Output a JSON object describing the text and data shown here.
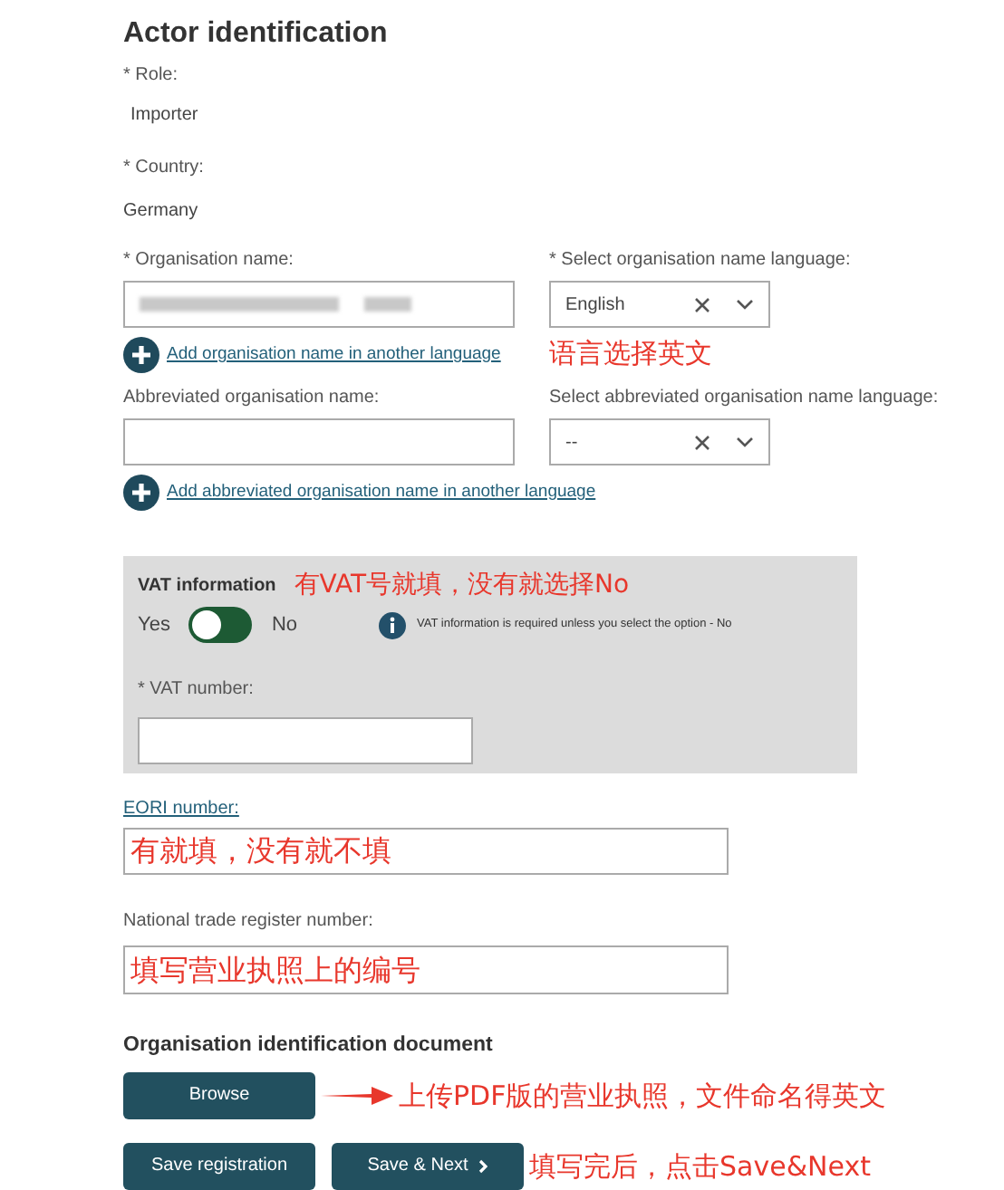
{
  "title": "Actor identification",
  "role": {
    "label": "* Role:",
    "value": "Importer"
  },
  "country": {
    "label": "* Country:",
    "value": "Germany"
  },
  "org_name": {
    "label": "* Organisation name:",
    "redacted": true,
    "add_link": "Add organisation name in another language"
  },
  "org_language": {
    "label": "* Select organisation name language:",
    "value": "English",
    "annotation": "语言选择英文"
  },
  "abbr_name": {
    "label": "Abbreviated organisation name:",
    "add_link": "Add abbreviated organisation name in another language"
  },
  "abbr_language": {
    "label": "Select abbreviated organisation name language:",
    "value": "--"
  },
  "vat": {
    "title": "VAT information",
    "annotation": "有VAT号就填，没有就选择No",
    "yes": "Yes",
    "no": "No",
    "on": false,
    "info": "VAT information is required unless you select the option - No",
    "number_label": "* VAT number:"
  },
  "eori": {
    "label": "EORI number:",
    "annotation": "有就填，没有就不填"
  },
  "trade_register": {
    "label": "National trade register number:",
    "annotation": "填写营业执照上的编号"
  },
  "document": {
    "title": "Organisation identification document",
    "browse": "Browse",
    "annotation": "上传PDF版的营业执照，文件命名得英文"
  },
  "buttons": [
    {
      "label": "Save registration",
      "kind": "plain"
    },
    {
      "label": "Save & Next",
      "kind": "next"
    }
  ],
  "buttons_annotation": "填写完后，点击Save&Next"
}
